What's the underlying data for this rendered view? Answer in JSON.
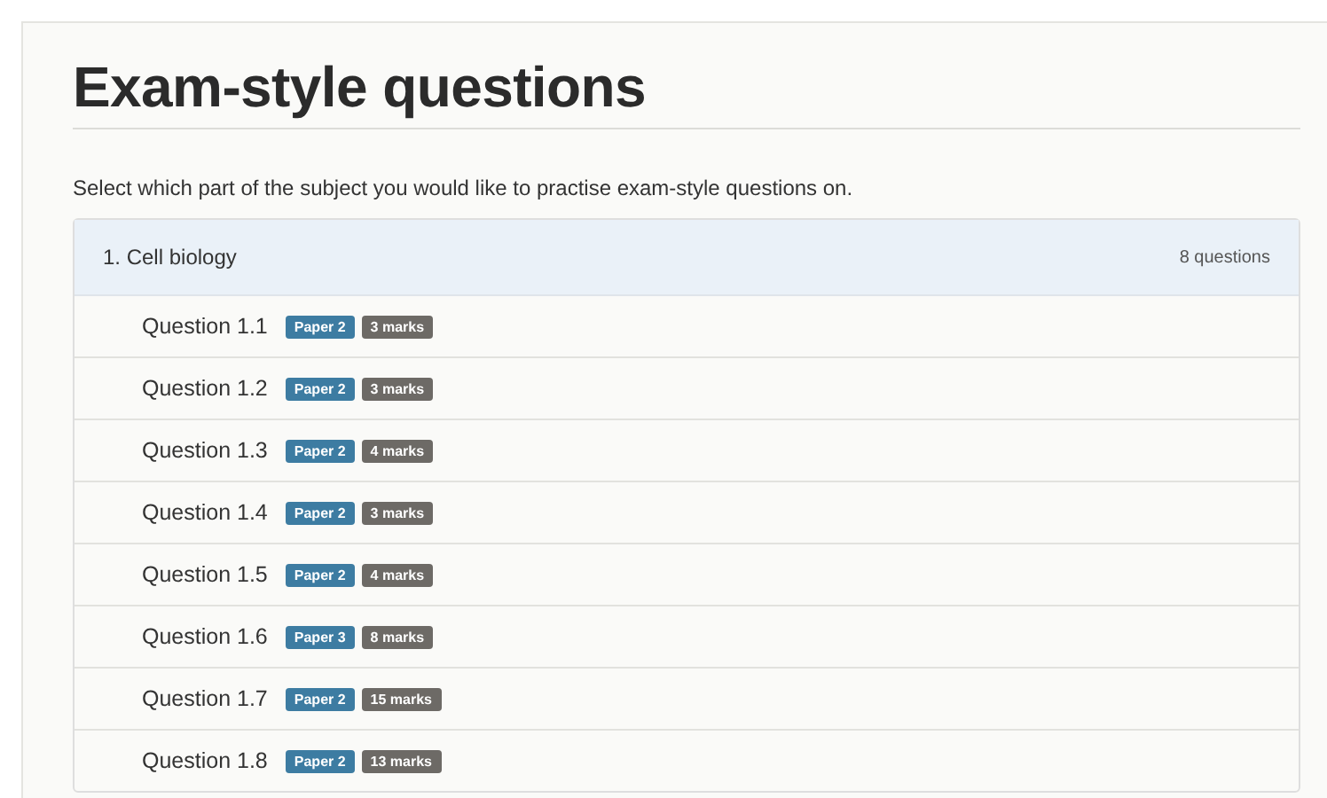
{
  "title": "Exam-style questions",
  "intro": "Select which part of the subject you would like to practise exam-style questions on.",
  "section": {
    "name": "1. Cell biology",
    "count": "8 questions",
    "questions": [
      {
        "label": "Question 1.1",
        "paper": "Paper 2",
        "marks": "3 marks"
      },
      {
        "label": "Question 1.2",
        "paper": "Paper 2",
        "marks": "3 marks"
      },
      {
        "label": "Question 1.3",
        "paper": "Paper 2",
        "marks": "4 marks"
      },
      {
        "label": "Question 1.4",
        "paper": "Paper 2",
        "marks": "3 marks"
      },
      {
        "label": "Question 1.5",
        "paper": "Paper 2",
        "marks": "4 marks"
      },
      {
        "label": "Question 1.6",
        "paper": "Paper 3",
        "marks": "8 marks"
      },
      {
        "label": "Question 1.7",
        "paper": "Paper 2",
        "marks": "15 marks"
      },
      {
        "label": "Question 1.8",
        "paper": "Paper 2",
        "marks": "13 marks"
      }
    ]
  }
}
